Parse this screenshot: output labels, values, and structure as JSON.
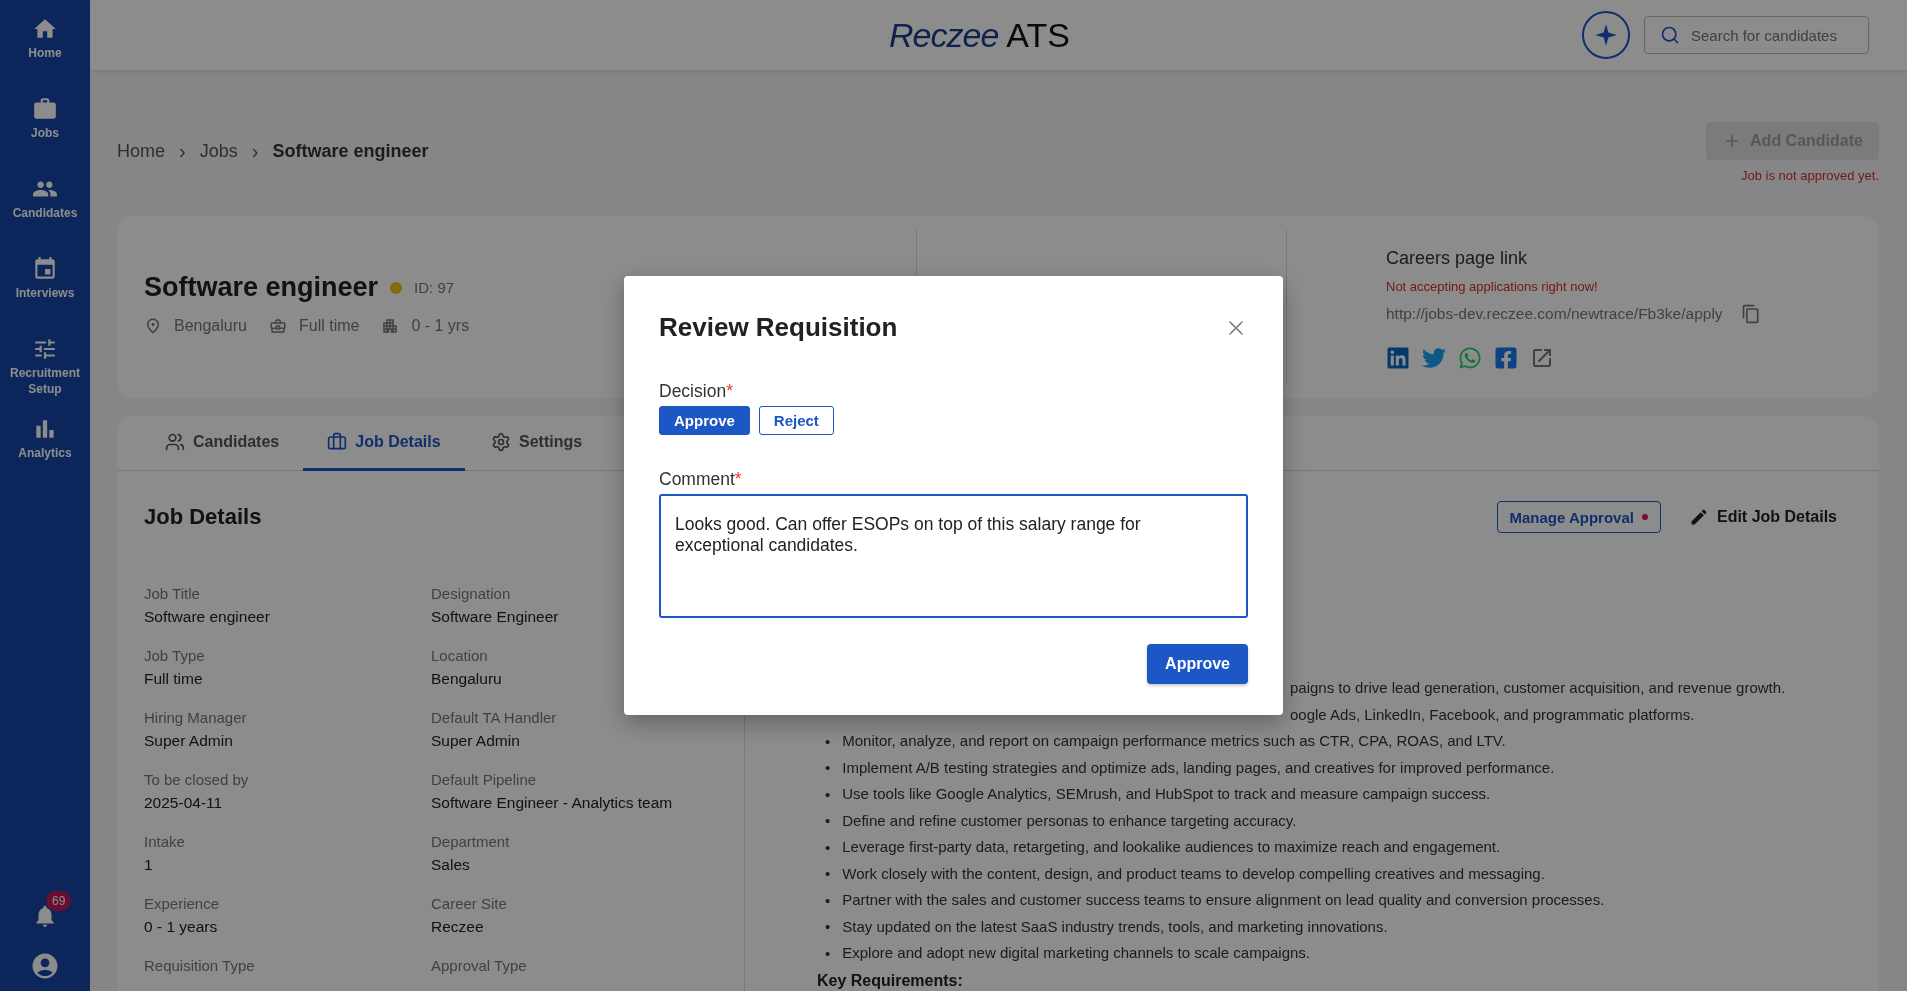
{
  "sidebar": {
    "items": [
      {
        "label": "Home"
      },
      {
        "label": "Jobs"
      },
      {
        "label": "Candidates"
      },
      {
        "label": "Interviews"
      },
      {
        "label": "Recruitment Setup"
      },
      {
        "label": "Analytics"
      }
    ],
    "notifications": "69"
  },
  "header": {
    "logo": {
      "brand": "Reczee",
      "product": "ATS"
    },
    "search": {
      "placeholder": "Search for candidates"
    }
  },
  "breadcrumb": [
    "Home",
    "Jobs",
    "Software engineer"
  ],
  "breadcrumb_separator": "›",
  "add_candidate": {
    "label": "Add Candidate",
    "disabled": true,
    "note": "Job is not approved yet."
  },
  "job": {
    "title": "Software engineer",
    "id": "ID: 97",
    "meta": [
      "Bengaluru",
      "Full time",
      "0 - 1 yrs"
    ]
  },
  "careers": {
    "title": "Careers page link",
    "status": "Not accepting applications right now!",
    "url": "http://jobs-dev.reczee.com/newtrace/Fb3ke/apply"
  },
  "tabs": [
    {
      "label": "Candidates",
      "selected": false
    },
    {
      "label": "Job Details",
      "selected": true
    },
    {
      "label": "Settings",
      "selected": false
    }
  ],
  "job_details": {
    "heading": "Job Details",
    "manage_approval": "Manage Approval",
    "edit": "Edit Job Details",
    "fields": [
      {
        "label": "Job Title",
        "value": "Software engineer"
      },
      {
        "label": "Designation",
        "value": "Software Engineer"
      },
      {
        "label": "Job Type",
        "value": "Full time"
      },
      {
        "label": "Location",
        "value": "Bengaluru"
      },
      {
        "label": "Hiring Manager",
        "value": "Super Admin"
      },
      {
        "label": "Default TA Handler",
        "value": "Super Admin"
      },
      {
        "label": "To be closed by",
        "value": "2025-04-11"
      },
      {
        "label": "Default Pipeline",
        "value": "Software Engineer - Analytics team"
      },
      {
        "label": "Intake",
        "value": "1"
      },
      {
        "label": "Department",
        "value": "Sales"
      },
      {
        "label": "Experience",
        "value": "0 - 1 years"
      },
      {
        "label": "Career Site",
        "value": "Reczee"
      },
      {
        "label": "Requisition Type"
      },
      {
        "label": "Approval Type"
      }
    ],
    "bullet_mark": "•",
    "bullets": [
      {
        "kind": "fragment",
        "text": "paigns to drive lead generation, customer acquisition, and revenue growth."
      },
      {
        "kind": "fragment",
        "text": "oogle Ads, LinkedIn, Facebook, and programmatic platforms."
      },
      {
        "kind": "item",
        "text": "Monitor, analyze, and report on campaign performance metrics such as CTR, CPA, ROAS, and LTV."
      },
      {
        "kind": "item",
        "text": "Implement A/B testing strategies and optimize ads, landing pages, and creatives for improved performance."
      },
      {
        "kind": "item",
        "text": "Use tools like Google Analytics, SEMrush, and HubSpot to track and measure campaign success."
      },
      {
        "kind": "item",
        "text": "Define and refine customer personas to enhance targeting accuracy."
      },
      {
        "kind": "item",
        "text": "Leverage first-party data, retargeting, and lookalike audiences to maximize reach and engagement."
      },
      {
        "kind": "item",
        "text": "Work closely with the content, design, and product teams to develop compelling creatives and messaging."
      },
      {
        "kind": "item",
        "text": "Partner with the sales and customer success teams to ensure alignment on lead quality and conversion processes."
      },
      {
        "kind": "item",
        "text": "Stay updated on the latest SaaS industry trends, tools, and marketing innovations."
      },
      {
        "kind": "item",
        "text": "Explore and adopt new digital marketing channels to scale campaigns."
      }
    ],
    "next_heading": "Key Requirements:"
  },
  "modal": {
    "title": "Review Requisition",
    "required_mark": "*",
    "decision_label": "Decision",
    "options": [
      {
        "label": "Approve",
        "selected": true
      },
      {
        "label": "Reject",
        "selected": false
      }
    ],
    "comment_label": "Comment",
    "comment": "Looks good. Can offer ESOPs on top of this salary range for exceptional candidates.",
    "submit": "Approve"
  }
}
